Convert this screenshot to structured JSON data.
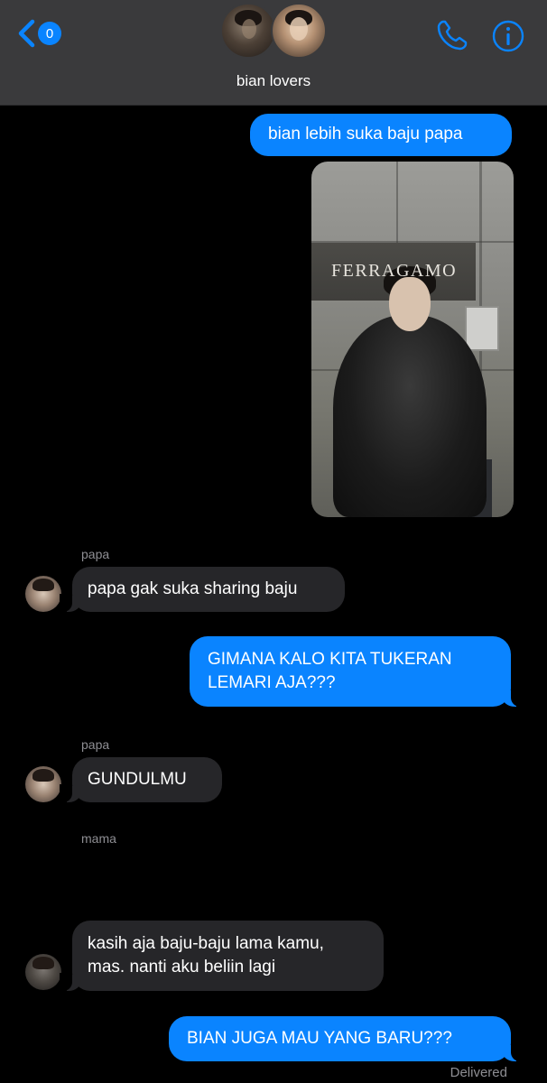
{
  "header": {
    "unread_count": "0",
    "group_name": "bian lovers",
    "accent_color": "#0a84ff",
    "icons": [
      "back-chevron-icon",
      "phone-icon",
      "info-icon"
    ]
  },
  "messages": [
    {
      "direction": "out",
      "text": "bian lebih suka baju papa"
    },
    {
      "direction": "out",
      "type": "image",
      "image_text": "FERRAGAMO"
    },
    {
      "direction": "in",
      "sender": "papa",
      "text": "papa gak suka sharing baju"
    },
    {
      "direction": "out",
      "text_line1": "GIMANA KALO KITA TUKERAN",
      "text_line2": "LEMARI AJA???"
    },
    {
      "direction": "in",
      "sender": "papa",
      "text": "GUNDULMU"
    },
    {
      "direction": "in",
      "sender": "mama",
      "emoji": "😭😭😭"
    },
    {
      "direction": "in",
      "text_line1": "kasih aja baju-baju lama kamu,",
      "text_line2": "mas. nanti aku beliin lagi"
    },
    {
      "direction": "out",
      "text": "BIAN JUGA MAU YANG BARU???"
    }
  ],
  "status": "Delivered"
}
